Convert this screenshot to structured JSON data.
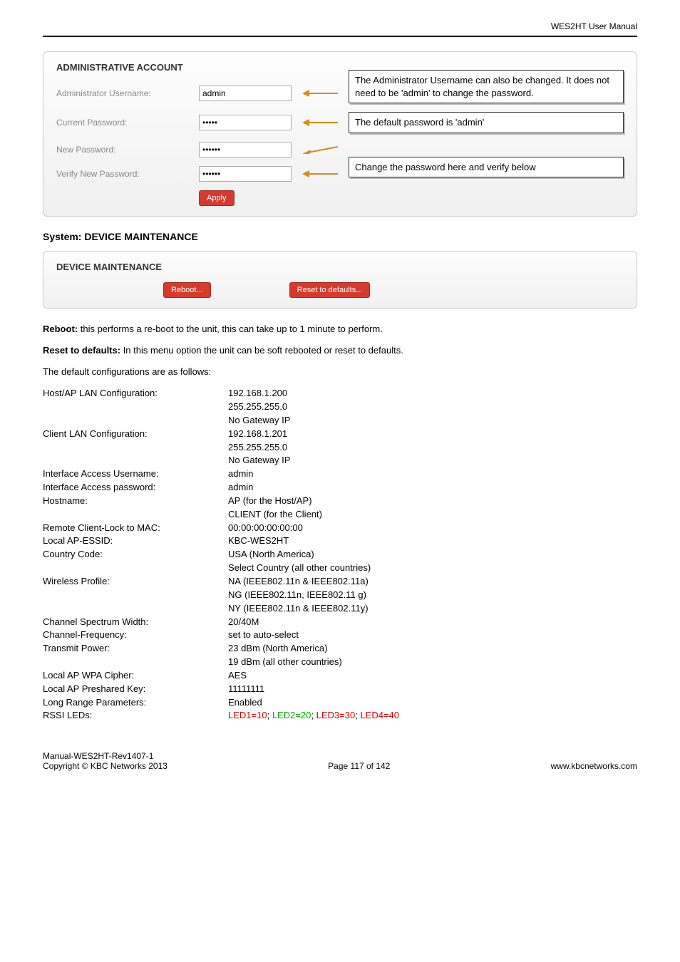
{
  "header": {
    "doc_title": "WES2HT User Manual"
  },
  "admin_panel": {
    "title": "ADMINISTRATIVE ACCOUNT",
    "rows": {
      "username_label": "Administrator Username:",
      "username_value": "admin",
      "curpw_label": "Current Password:",
      "curpw_value": "•••••",
      "newpw_label": "New Password:",
      "newpw_value": "••••••",
      "verify_label": "Verify New Password:",
      "verify_value": "••••••"
    },
    "callouts": {
      "c1": "The Administrator Username can also be changed. It does not need to be 'admin' to change the password.",
      "c2": "The default password is 'admin'",
      "c3": "Change the password here and verify below"
    },
    "apply": "Apply"
  },
  "section_maint_heading": "System: DEVICE MAINTENANCE",
  "maint_panel": {
    "title": "DEVICE MAINTENANCE",
    "reboot": "Reboot...",
    "reset": "Reset to defaults..."
  },
  "para1_bold": "Reboot:",
  "para1_rest": " this performs a re-boot to the unit, this can take up to 1 minute to perform.",
  "para2_bold": "Reset to defaults:",
  "para2_rest": " In this menu option the unit can be soft rebooted or reset to defaults.",
  "para3": "The default configurations are as follows:",
  "config": [
    {
      "label": "Host/AP LAN Configuration:",
      "value": "192.168.1.200"
    },
    {
      "label": "",
      "value": "255.255.255.0"
    },
    {
      "label": "",
      "value": "No Gateway IP"
    },
    {
      "label": "Client LAN Configuration:",
      "value": "192.168.1.201"
    },
    {
      "label": "",
      "value": "255.255.255.0"
    },
    {
      "label": "",
      "value": "No Gateway IP"
    },
    {
      "label": "Interface Access Username:",
      "value": "admin"
    },
    {
      "label": "Interface Access password:",
      "value": "admin"
    },
    {
      "label": "Hostname:",
      "value": "AP (for the Host/AP)"
    },
    {
      "label": "",
      "value": "CLIENT (for the Client)"
    },
    {
      "label": "Remote Client-Lock to MAC:",
      "value": "00:00:00:00:00:00"
    },
    {
      "label": "Local AP-ESSID:",
      "value": "KBC-WES2HT"
    },
    {
      "label": "Country Code:",
      "value": "USA (North America)"
    },
    {
      "label": "",
      "value": "Select Country (all other countries)"
    },
    {
      "label": "Wireless Profile:",
      "value": "NA (IEEE802.11n & IEEE802.11a)"
    },
    {
      "label": "",
      "value": "NG (IEEE802.11n, IEEE802.11 g)"
    },
    {
      "label": "",
      "value": "NY (IEEE802.11n & IEEE802.11y)"
    },
    {
      "label": "Channel Spectrum Width:",
      "value": "20/40M"
    },
    {
      "label": "Channel-Frequency:",
      "value": "set to auto-select"
    },
    {
      "label": "Transmit Power:",
      "value": "23 dBm (North America)"
    },
    {
      "label": "",
      "value": "19 dBm (all other countries)"
    },
    {
      "label": "Local AP WPA Cipher:",
      "value": "AES"
    },
    {
      "label": "Local AP Preshared Key:",
      "value": "11111111"
    },
    {
      "label": "Long Range Parameters:",
      "value": "Enabled"
    }
  ],
  "rssi": {
    "label": "RSSI LEDs:",
    "led1": "LED1=10",
    "sep1": "; ",
    "led2": "LED2=20",
    "sep2": "; ",
    "led3": "LED3=30",
    "sep3": "; ",
    "led4": "LED4=40"
  },
  "footer": {
    "left1": "Manual-WES2HT-Rev1407-1",
    "left2": "Copyright © KBC Networks 2013",
    "center": "Page 117 of 142",
    "right": "www.kbcnetworks.com"
  }
}
